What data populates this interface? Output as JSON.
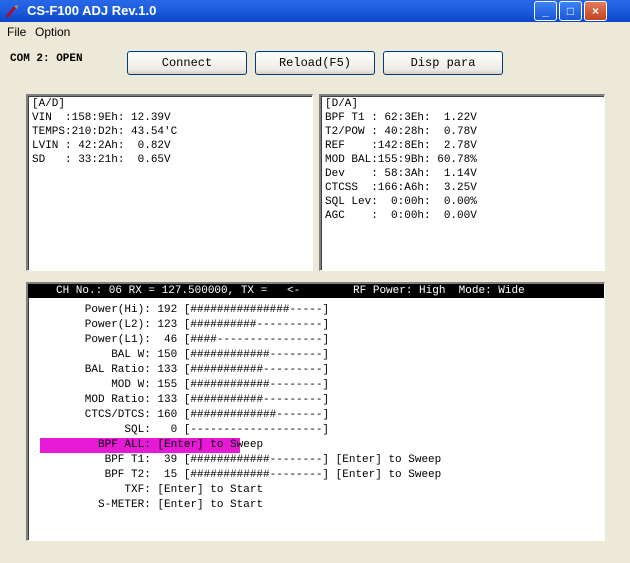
{
  "window": {
    "title": "CS-F100 ADJ Rev.1.0",
    "minimize_label": "_",
    "maximize_label": "□",
    "close_label": "×"
  },
  "menu": {
    "items": [
      "File",
      "Option"
    ]
  },
  "toolbar": {
    "com_status": "COM 2: OPEN",
    "connect_label": "Connect",
    "reload_label": "Reload(F5)",
    "disp_para_label": "Disp para"
  },
  "ad_panel": {
    "lines": [
      "[A/D]",
      "VIN  :158:9Eh: 12.39V",
      "TEMPS:210:D2h: 43.54'C",
      "LVIN : 42:2Ah:  0.82V",
      "SD   : 33:21h:  0.65V"
    ]
  },
  "da_panel": {
    "lines": [
      "[D/A]",
      "BPF T1 : 62:3Eh:  1.22V",
      "T2/POW : 40:28h:  0.78V",
      "REF    :142:8Eh:  2.78V",
      "MOD BAL:155:9Bh: 60.78%",
      "Dev    : 58:3Ah:  1.14V",
      "CTCSS  :166:A6h:  3.25V",
      "SQL Lev:  0:00h:  0.00%",
      "AGC    :  0:00h:  0.00V"
    ]
  },
  "channel_header": "CH No.: 06 RX = 127.500000, TX =   <-        RF Power: High  Mode: Wide",
  "params": [
    {
      "name": "Power(Hi)",
      "value": "192",
      "rest": "[###############-----]"
    },
    {
      "name": "Power(L2)",
      "value": "123",
      "rest": "[##########----------]"
    },
    {
      "name": "Power(L1)",
      "value": "46",
      "rest": "[####----------------]"
    },
    {
      "name": "BAL W",
      "value": "150",
      "rest": "[############--------]"
    },
    {
      "name": "BAL Ratio",
      "value": "133",
      "rest": "[###########---------]"
    },
    {
      "name": "MOD W",
      "value": "155",
      "rest": "[############--------]"
    },
    {
      "name": "MOD Ratio",
      "value": "133",
      "rest": "[###########---------]"
    },
    {
      "name": "CTCS/DTCS",
      "value": "160",
      "rest": "[#############-------]"
    },
    {
      "name": "SQL",
      "value": "0",
      "rest": "[--------------------]"
    },
    {
      "name": "BPF ALL",
      "value": "",
      "rest": "[Enter] to Sweep"
    },
    {
      "name": "BPF T1",
      "value": "39",
      "rest": "[############--------] [Enter] to Sweep"
    },
    {
      "name": "BPF T2",
      "value": "15",
      "rest": "[############--------] [Enter] to Sweep"
    },
    {
      "name": "TXF",
      "value": "",
      "rest": "[Enter] to Start"
    },
    {
      "name": "S-METER",
      "value": "",
      "rest": "[Enter] to Start"
    }
  ],
  "selected_index": 9,
  "colors": {
    "titlebar": "#0a47c8",
    "highlight": "#e61ad6",
    "header_bg": "#000000"
  }
}
